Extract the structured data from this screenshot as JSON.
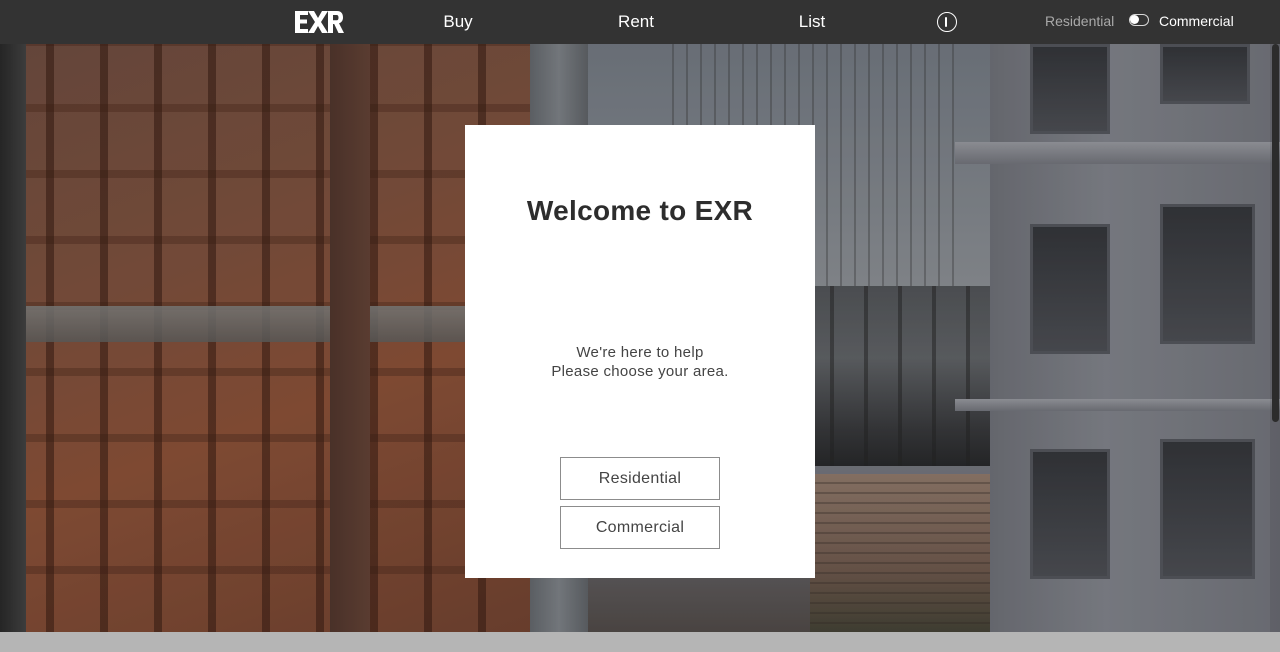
{
  "header": {
    "logo_text": "EXR",
    "nav": {
      "buy": "Buy",
      "rent": "Rent",
      "list": "List"
    },
    "info_icon": "info-icon",
    "mode_toggle": {
      "left_label": "Residential",
      "right_label": "Commercial",
      "state": "residential"
    }
  },
  "modal": {
    "title": "Welcome to EXR",
    "line1": "We're here to help",
    "line2": "Please choose your area.",
    "buttons": {
      "residential": "Residential",
      "commercial": "Commercial"
    }
  },
  "colors": {
    "nav_bg": "#333333",
    "modal_bg": "#ffffff",
    "text_dark": "#2d2d2d",
    "muted": "#a9a9a9"
  }
}
